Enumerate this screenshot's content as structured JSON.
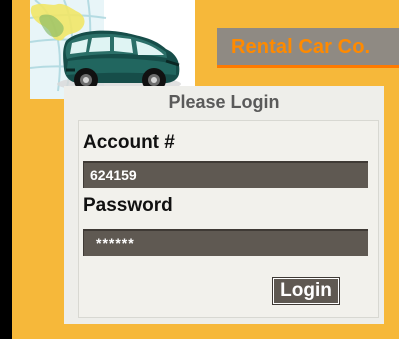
{
  "brand": {
    "name": "Rental Car Co."
  },
  "login": {
    "title": "Please Login",
    "account_label": "Account #",
    "account_value": "624159",
    "password_label": "Password",
    "password_value": "******",
    "button_label": "Login"
  },
  "icons": {
    "hero": "car-and-globe-image"
  },
  "colors": {
    "background": "#f6b83a",
    "banner": "#8f8a83",
    "brand_text": "#ff8a00",
    "field_fill": "#5f5952",
    "panel": "#eeeeea"
  }
}
